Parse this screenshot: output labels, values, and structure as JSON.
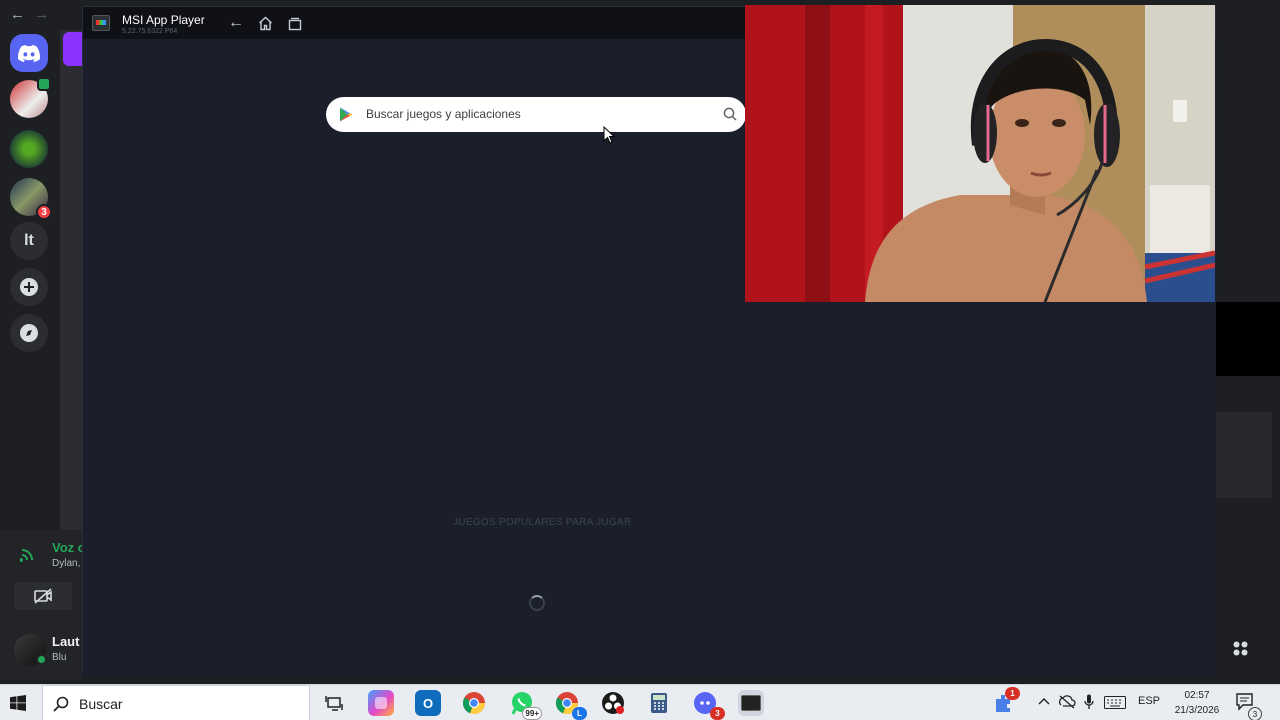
{
  "discord": {
    "rail": {
      "text_server_label": "lt",
      "server_badge_count": "3"
    },
    "voice": {
      "title": "Voz c",
      "subtitle": "Dylan,"
    },
    "user": {
      "name": "Laut",
      "activity": "Blu"
    }
  },
  "msi_player": {
    "title": "MSI App Player",
    "version": "5.22.75.6322 P64",
    "search_placeholder": "Buscar juegos y aplicaciones",
    "section_label": "JUEGOS POPULARES PARA JUGAR"
  },
  "taskbar": {
    "search_label": "Buscar",
    "whatsapp_badge": "99+",
    "discord_badge": "3",
    "tray_badge": "1",
    "language": "ESP",
    "time": "02:57",
    "date": "21/3/2026",
    "notification_count": "3"
  },
  "colors": {
    "discord_blurple": "#5865f2",
    "discord_green": "#23a55a",
    "emulator_bg": "#1b1f2b",
    "taskbar_bg": "#e9edf2"
  }
}
